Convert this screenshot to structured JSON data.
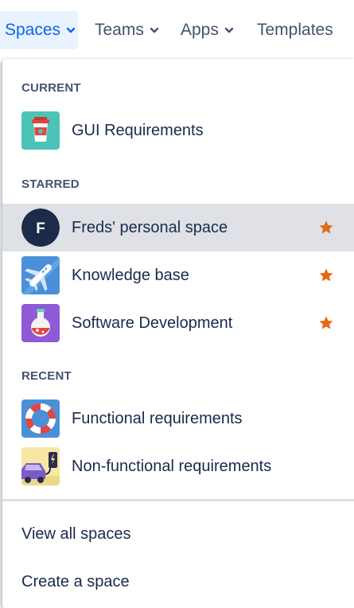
{
  "nav": {
    "spaces": "Spaces",
    "teams": "Teams",
    "apps": "Apps",
    "templates": "Templates"
  },
  "dropdown": {
    "current_heading": "CURRENT",
    "current": [
      {
        "label": "GUI Requirements",
        "icon": "coffee-cup-icon"
      }
    ],
    "starred_heading": "STARRED",
    "starred": [
      {
        "label": "Freds' personal space",
        "icon": "avatar-initial",
        "initial": "F",
        "starred": true,
        "highlighted": true
      },
      {
        "label": "Knowledge base",
        "icon": "airplane-icon",
        "starred": true
      },
      {
        "label": "Software Development",
        "icon": "potion-flask-icon",
        "starred": true
      }
    ],
    "recent_heading": "RECENT",
    "recent": [
      {
        "label": "Functional requirements",
        "icon": "lifebuoy-icon"
      },
      {
        "label": "Non-functional requirements",
        "icon": "electric-car-icon"
      }
    ],
    "view_all": "View all spaces",
    "create": "Create a space"
  },
  "colors": {
    "accent": "#0c66e4",
    "star": "#e56910",
    "highlight": "#dfe1e6"
  }
}
